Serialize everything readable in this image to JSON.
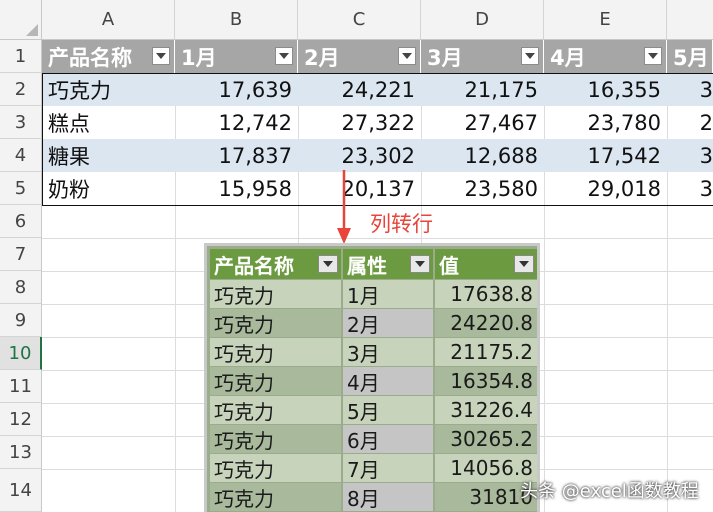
{
  "columns": [
    "A",
    "B",
    "C",
    "D",
    "E"
  ],
  "rows": [
    "1",
    "2",
    "3",
    "4",
    "5",
    "6",
    "7",
    "8",
    "9",
    "10",
    "11",
    "12",
    "13",
    "14"
  ],
  "selected_row": "10",
  "source_table": {
    "headers": [
      "产品名称",
      "1月",
      "2月",
      "3月",
      "4月",
      "5月"
    ],
    "rows": [
      [
        "巧克力",
        "17,639",
        "24,221",
        "21,175",
        "16,355",
        "3"
      ],
      [
        "糕点",
        "12,742",
        "27,322",
        "27,467",
        "23,780",
        "2"
      ],
      [
        "糖果",
        "17,837",
        "23,302",
        "12,688",
        "17,542",
        "3"
      ],
      [
        "奶粉",
        "15,958",
        "20,137",
        "23,580",
        "29,018",
        "3"
      ]
    ]
  },
  "annotation": "列转行",
  "result_table": {
    "headers": [
      "产品名称",
      "属性",
      "值"
    ],
    "rows": [
      [
        "巧克力",
        "1月",
        "17638.8"
      ],
      [
        "巧克力",
        "2月",
        "24220.8"
      ],
      [
        "巧克力",
        "3月",
        "21175.2"
      ],
      [
        "巧克力",
        "4月",
        "16354.8"
      ],
      [
        "巧克力",
        "5月",
        "31226.4"
      ],
      [
        "巧克力",
        "6月",
        "30265.2"
      ],
      [
        "巧克力",
        "7月",
        "14056.8"
      ],
      [
        "巧克力",
        "8月",
        "31810"
      ]
    ]
  },
  "watermark": "头条 @excel函数教程",
  "colors": {
    "accent": "#217346",
    "header_gray": "#a6a6a6",
    "band_blue": "#dce6f1",
    "result_header": "#6b9a41",
    "annotation": "#e8443a"
  }
}
